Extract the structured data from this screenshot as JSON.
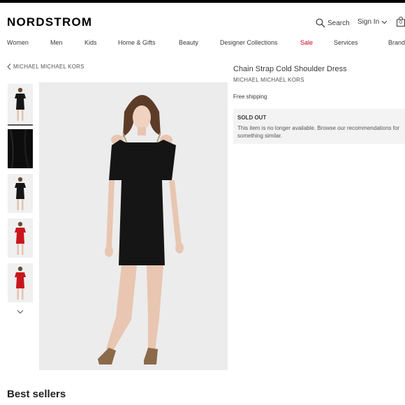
{
  "header": {
    "logo": "NORDSTROM",
    "search_label": "Search",
    "signin_label": "Sign In",
    "bag_count": "0"
  },
  "nav": {
    "items": [
      "Women",
      "Men",
      "Kids",
      "Home & Gifts",
      "Beauty",
      "Designer Collections",
      "Sale",
      "Services",
      "Brand"
    ]
  },
  "breadcrumb": {
    "label": "MICHAEL MICHAEL KORS"
  },
  "product": {
    "title": "Chain Strap Cold Shoulder Dress",
    "brand": "MICHAEL MICHAEL KORS",
    "shipping": "Free shipping",
    "status_title": "SOLD OUT",
    "status_message": "This item is no longer available. Browse our recommendations for something similar."
  },
  "section": {
    "best_sellers": "Best sellers"
  },
  "colors": {
    "sale": "#d0021b",
    "text": "#393939",
    "dress_black": "#151515",
    "dress_red": "#c8161d"
  }
}
